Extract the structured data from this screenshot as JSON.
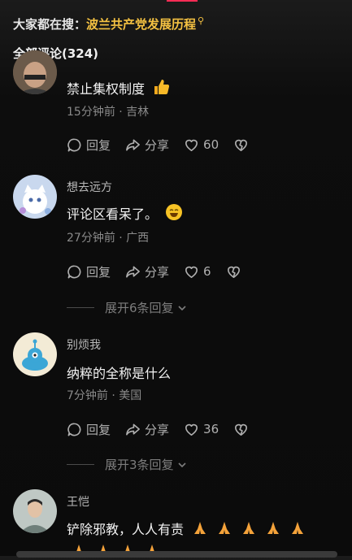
{
  "search": {
    "prefix": "大家都在搜：",
    "keyword": "波兰共产党发展历程",
    "icon": "search-icon"
  },
  "header": {
    "title": "全部评论(324)"
  },
  "actions": {
    "reply": "回复",
    "share": "分享"
  },
  "comments": [
    {
      "author": "",
      "text": "禁止集权制度",
      "time": "15分钟前 · 吉林",
      "likes": "60",
      "emoji": "thumbs-up-icon"
    },
    {
      "author": "想去远方",
      "text": "评论区看呆了。",
      "time": "27分钟前 · 广西",
      "likes": "6",
      "emoji": "laughing-face-icon",
      "expand": "展开6条回复"
    },
    {
      "author": "别烦我",
      "text": "纳粹的全称是什么",
      "time": "7分钟前 · 美国",
      "likes": "36",
      "expand": "展开3条回复"
    },
    {
      "author": "王恺",
      "text": "铲除邪教，人人有责",
      "emoji": "folded-hands-icon"
    }
  ],
  "colors": {
    "accent": "#fe2c55",
    "keyword": "#f5c242",
    "background": "#0b0b0b"
  }
}
